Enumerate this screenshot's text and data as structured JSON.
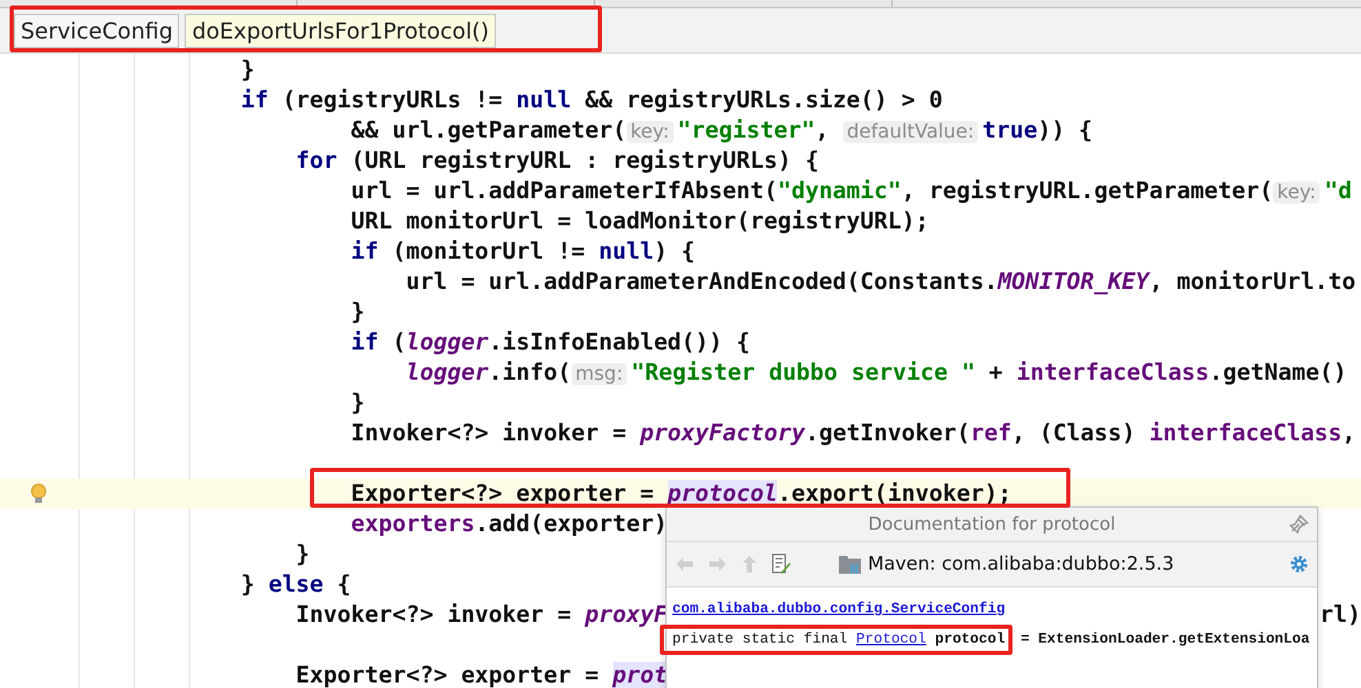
{
  "breadcrumbs": [
    {
      "label": "ServiceConfig",
      "selected": false
    },
    {
      "label": "doExportUrlsFor1Protocol()",
      "selected": true
    }
  ],
  "code_lines": [
    {
      "current": false,
      "tokens": [
        {
          "kind": "plain",
          "text": "                }"
        }
      ]
    },
    {
      "current": false,
      "tokens": [
        {
          "kind": "keyword",
          "text": "                if"
        },
        {
          "kind": "plain",
          "text": " (registryURLs != "
        },
        {
          "kind": "keyword",
          "text": "null"
        },
        {
          "kind": "plain",
          "text": " && registryURLs.size() > 0"
        }
      ]
    },
    {
      "current": false,
      "tokens": [
        {
          "kind": "plain",
          "text": "                        && url.getParameter("
        },
        {
          "kind": "hint",
          "text": "key:"
        },
        {
          "kind": "string",
          "text": "\"register\""
        },
        {
          "kind": "plain",
          "text": ", "
        },
        {
          "kind": "hint",
          "text": "defaultValue:"
        },
        {
          "kind": "keyword",
          "text": "true"
        },
        {
          "kind": "plain",
          "text": ")) {"
        }
      ]
    },
    {
      "current": false,
      "tokens": [
        {
          "kind": "keyword",
          "text": "                    for"
        },
        {
          "kind": "plain",
          "text": " (URL registryURL : registryURLs) {"
        }
      ]
    },
    {
      "current": false,
      "tokens": [
        {
          "kind": "plain",
          "text": "                        url = url.addParameterIfAbsent("
        },
        {
          "kind": "string",
          "text": "\"dynamic\""
        },
        {
          "kind": "plain",
          "text": ", registryURL.getParameter("
        },
        {
          "kind": "hint",
          "text": "key:"
        },
        {
          "kind": "string",
          "text": "\"d"
        }
      ]
    },
    {
      "current": false,
      "tokens": [
        {
          "kind": "plain",
          "text": "                        URL monitorUrl = loadMonitor(registryURL);"
        }
      ]
    },
    {
      "current": false,
      "tokens": [
        {
          "kind": "keyword",
          "text": "                        if"
        },
        {
          "kind": "plain",
          "text": " (monitorUrl != "
        },
        {
          "kind": "keyword",
          "text": "null"
        },
        {
          "kind": "plain",
          "text": ") {"
        }
      ]
    },
    {
      "current": false,
      "tokens": [
        {
          "kind": "plain",
          "text": "                            url = url.addParameterAndEncoded(Constants."
        },
        {
          "kind": "static",
          "text": "MONITOR_KEY"
        },
        {
          "kind": "plain",
          "text": ", monitorUrl.to"
        }
      ]
    },
    {
      "current": false,
      "tokens": [
        {
          "kind": "plain",
          "text": "                        }"
        }
      ]
    },
    {
      "current": false,
      "tokens": [
        {
          "kind": "keyword",
          "text": "                        if"
        },
        {
          "kind": "plain",
          "text": " ("
        },
        {
          "kind": "static",
          "text": "logger"
        },
        {
          "kind": "plain",
          "text": ".isInfoEnabled()) {"
        }
      ]
    },
    {
      "current": false,
      "tokens": [
        {
          "kind": "static",
          "text": "                            logger"
        },
        {
          "kind": "plain",
          "text": ".info("
        },
        {
          "kind": "hint",
          "text": "msg:"
        },
        {
          "kind": "string",
          "text": "\"Register dubbo service \""
        },
        {
          "kind": "plain",
          "text": " + "
        },
        {
          "kind": "field",
          "text": "interfaceClass"
        },
        {
          "kind": "plain",
          "text": ".getName()"
        }
      ]
    },
    {
      "current": false,
      "tokens": [
        {
          "kind": "plain",
          "text": "                        }"
        }
      ]
    },
    {
      "current": false,
      "tokens": [
        {
          "kind": "plain",
          "text": "                        Invoker<?> invoker = "
        },
        {
          "kind": "static",
          "text": "proxyFactory"
        },
        {
          "kind": "plain",
          "text": ".getInvoker("
        },
        {
          "kind": "field",
          "text": "ref"
        },
        {
          "kind": "plain",
          "text": ", (Class) "
        },
        {
          "kind": "field",
          "text": "interfaceClass"
        },
        {
          "kind": "plain",
          "text": ","
        }
      ]
    },
    {
      "current": false
    },
    {
      "current": true,
      "tokens": [
        {
          "kind": "plain",
          "text": "                        Exporter<?> exporter = "
        },
        {
          "kind": "usage",
          "text": "protocol"
        },
        {
          "kind": "plain",
          "text": ".export(invoker);"
        }
      ]
    },
    {
      "current": false,
      "tokens": [
        {
          "kind": "field",
          "text": "                        exporters"
        },
        {
          "kind": "plain",
          "text": ".add(exporter)"
        }
      ]
    },
    {
      "current": false,
      "tokens": [
        {
          "kind": "plain",
          "text": "                    }"
        }
      ]
    },
    {
      "current": false,
      "tokens": [
        {
          "kind": "plain",
          "text": "                } "
        },
        {
          "kind": "keyword",
          "text": "else"
        },
        {
          "kind": "plain",
          "text": " {"
        }
      ]
    },
    {
      "current": false,
      "tail": "rl)",
      "tokens": [
        {
          "kind": "plain",
          "text": "                    Invoker<?> invoker = "
        },
        {
          "kind": "static",
          "text": "proxyF"
        }
      ]
    },
    {
      "current": false
    },
    {
      "current": false,
      "tokens": [
        {
          "kind": "plain",
          "text": "                    Exporter<?> exporter = "
        },
        {
          "kind": "usage",
          "text": "prot"
        }
      ]
    }
  ],
  "doc_popup": {
    "title": "Documentation for protocol",
    "library": "Maven: com.alibaba:dubbo:2.5.3",
    "class_link": "com.alibaba.dubbo.config.ServiceConfig",
    "declaration_prefix": "private static final ",
    "type_link": "Protocol",
    "declaration_name": " protocol",
    "declaration_rest": " = ExtensionLoader.getExtensionLoa"
  }
}
